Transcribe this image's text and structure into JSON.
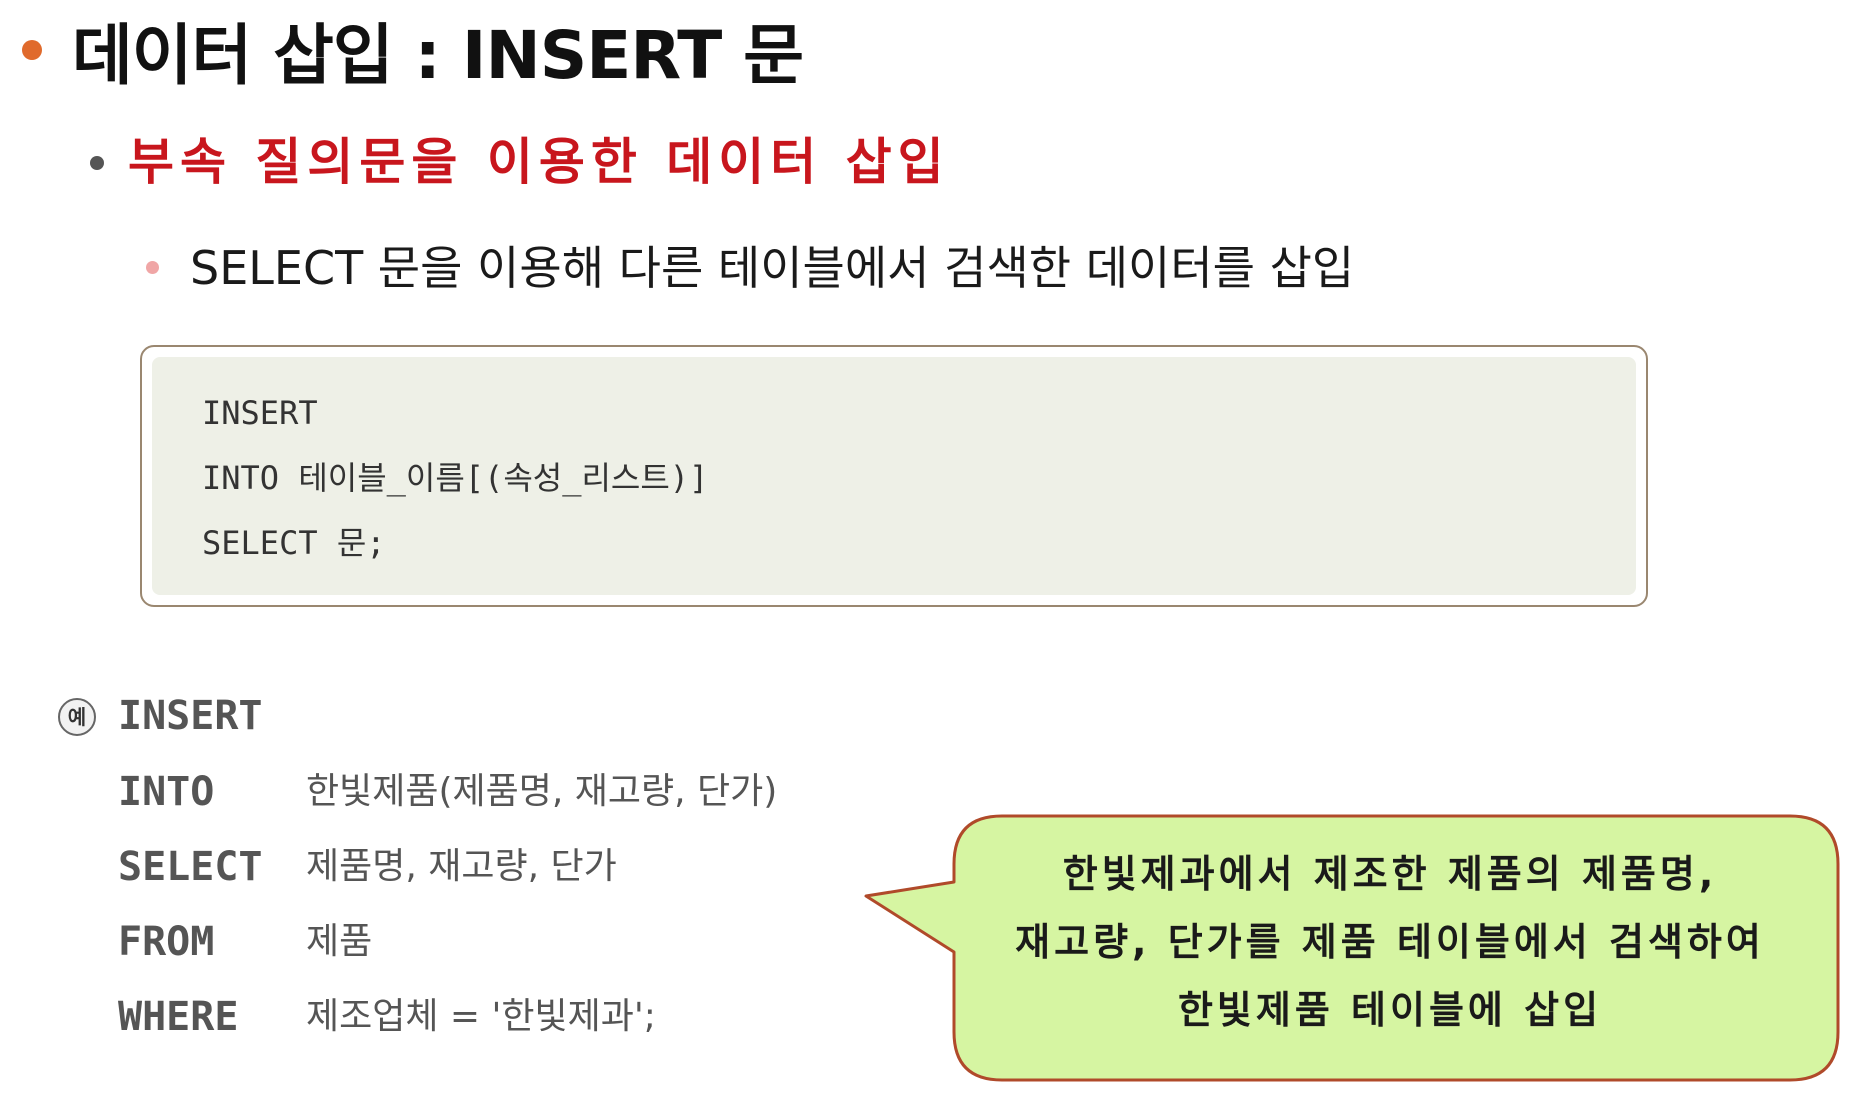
{
  "heading": "데이터 삽입 : INSERT 문",
  "subheading": "부속 질의문을 이용한 데이터 삽입",
  "description": "SELECT 문을 이용해 다른 테이블에서 검색한 데이터를 삽입",
  "syntax": {
    "lines": [
      "INSERT",
      "INTO  테이블_이름[(속성_리스트)]",
      "SELECT 문;"
    ]
  },
  "example": {
    "marker": "예",
    "rows": [
      {
        "keyword": "INSERT",
        "value": ""
      },
      {
        "keyword": "INTO",
        "value": "한빛제품(제품명, 재고량, 단가)"
      },
      {
        "keyword": "SELECT",
        "value": "제품명, 재고량, 단가"
      },
      {
        "keyword": "FROM",
        "value": "제품"
      },
      {
        "keyword": "WHERE",
        "value": "제조업체 = '한빛제과';"
      }
    ]
  },
  "callout": {
    "lines": [
      "한빛제과에서 제조한 제품의 제품명,",
      "재고량, 단가를 제품 테이블에서 검색하여",
      "한빛제품 테이블에 삽입"
    ],
    "fill_color": "#d6f5a2",
    "border_color": "#b04a2a"
  },
  "colors": {
    "heading_bullet": "#e06a2c",
    "subheading": "#c8161d",
    "description_bullet": "#f0a6a6",
    "syntax_background": "#eef0e7"
  }
}
